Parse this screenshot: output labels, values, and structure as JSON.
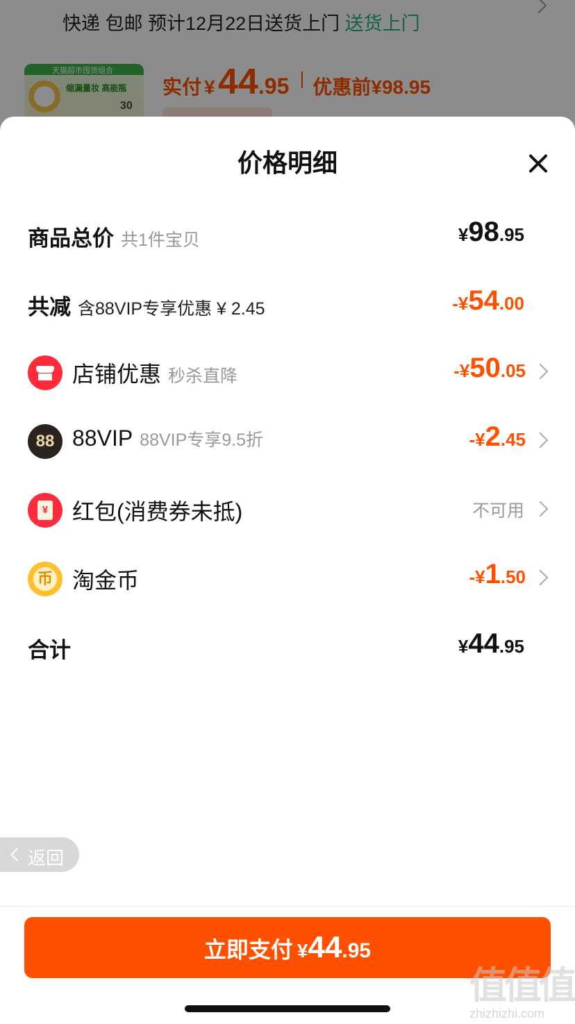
{
  "background": {
    "shipping": {
      "method": "快递",
      "free": "包邮",
      "estimate": "预计12月22日送货上门",
      "highlight": "送货上门"
    },
    "product_thumb": {
      "brand": "天猫超市囤货组合",
      "slogan": "缩漏量妆 高能瓶",
      "count": "30"
    },
    "price": {
      "paid_label": "实付",
      "yen": "¥",
      "paid_int": "44",
      "paid_dec": ".95",
      "before": "优惠前¥98.95"
    }
  },
  "sheet": {
    "title": "价格明细"
  },
  "rows": {
    "total": {
      "label": "商品总价",
      "sub": "共1件宝贝",
      "yen": "¥",
      "int": "98",
      "dec": ".95"
    },
    "reduce": {
      "label": "共减",
      "sub": "含88VIP专享优惠 ¥ 2.45",
      "yen": "-¥",
      "int": "54",
      "dec": ".00"
    },
    "store": {
      "icon": "store-icon",
      "label": "店铺优惠",
      "sub": "秒杀直降",
      "yen": "-¥",
      "int": "50",
      "dec": ".05"
    },
    "vip": {
      "icon": "vip-icon",
      "icon_text": "88",
      "label": "88VIP",
      "sub": "88VIP专享9.5折",
      "yen": "-¥",
      "int": "2",
      "dec": ".45"
    },
    "redpacket": {
      "icon": "red-envelope-icon",
      "icon_text": "¥",
      "label": "红包(消费券未抵)",
      "status": "不可用"
    },
    "coin": {
      "icon": "gold-coin-icon",
      "icon_text": "币",
      "label": "淘金币",
      "yen": "-¥",
      "int": "1",
      "dec": ".50"
    },
    "sum": {
      "label": "合计",
      "yen": "¥",
      "int": "44",
      "dec": ".95"
    }
  },
  "back": {
    "label": "返回"
  },
  "pay_button": {
    "label": "立即支付",
    "yen": "¥",
    "int": "44",
    "dec": ".95"
  },
  "watermark": {
    "logo": "值值值",
    "site": "zhizhizhi.com"
  },
  "colors": {
    "accent": "#ff5000",
    "green": "#27b07a",
    "muted": "#999999"
  }
}
